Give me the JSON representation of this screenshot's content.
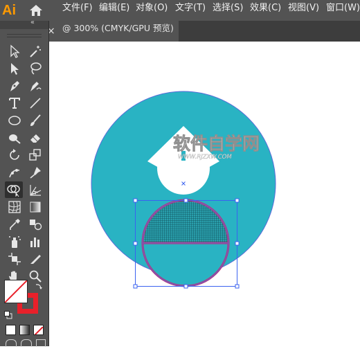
{
  "app": {
    "logo": "Ai"
  },
  "menu": [
    "文件(F)",
    "编辑(E)",
    "对象(O)",
    "文字(T)",
    "选择(S)",
    "效果(C)",
    "视图(V)",
    "窗口(W)"
  ],
  "document_tab": {
    "close": "×",
    "title": "@ 300% (CMYK/GPU 预览)"
  },
  "panel": {
    "collapse": "«"
  },
  "watermark": {
    "main": "软件自学网",
    "sub": "WWW.RJZXW.COM"
  },
  "colors": {
    "circle": "#29b3c3",
    "outline": "#5a6bd8",
    "selection": "#3a62f0",
    "magenta": "#c12e72",
    "fill_swatch": "#ffffff",
    "stroke_swatch": "#e8202a",
    "logo": "#ff9a00"
  },
  "tools": [
    "selection-tool-icon",
    "magic-wand-icon",
    "direct-selection-tool-icon",
    "lasso-tool-icon",
    "pen-tool-icon",
    "curvature-tool-icon",
    "type-tool-icon",
    "line-tool-icon",
    "ellipse-tool-icon",
    "paintbrush-tool-icon",
    "blob-brush-icon",
    "eraser-tool-icon",
    "rotate-tool-icon",
    "scale-tool-icon",
    "puppet-warp-icon",
    "pin-tool-icon",
    "shape-builder-icon",
    "perspective-grid-icon",
    "mesh-tool-icon",
    "gradient-tool-icon",
    "eyedropper-tool-icon",
    "blend-tool-icon",
    "symbol-sprayer-icon",
    "column-graph-icon",
    "artboard-tool-icon",
    "slice-tool-icon",
    "hand-tool-icon",
    "zoom-tool-icon"
  ]
}
